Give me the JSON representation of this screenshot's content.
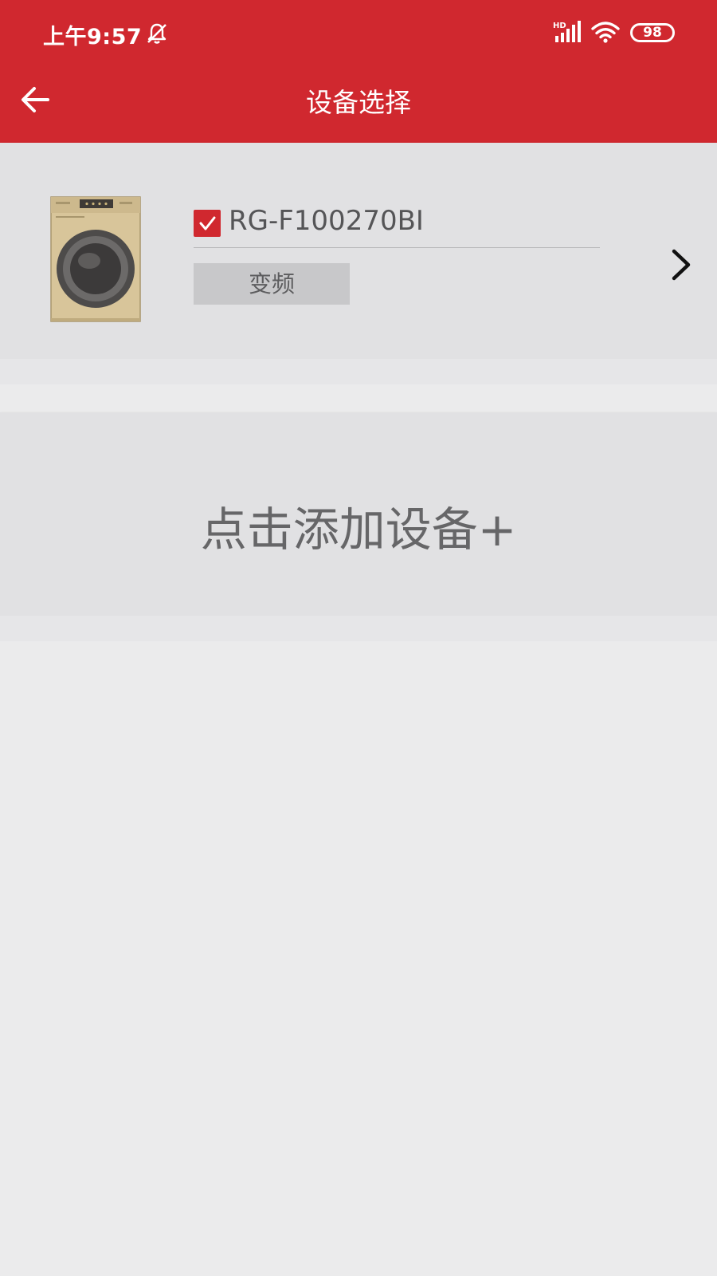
{
  "status_bar": {
    "time": "上午9:57",
    "battery": "98",
    "network": "HD"
  },
  "title_bar": {
    "title": "设备选择"
  },
  "device": {
    "model": "RG-F100270BI",
    "tag": "变频",
    "checked": true,
    "image": "washing-machine"
  },
  "add_device": {
    "label": "点击添加设备+"
  },
  "colors": {
    "brand_red": "#d0282f",
    "card_bg": "#e1e1e3",
    "page_bg": "#ebebec"
  }
}
